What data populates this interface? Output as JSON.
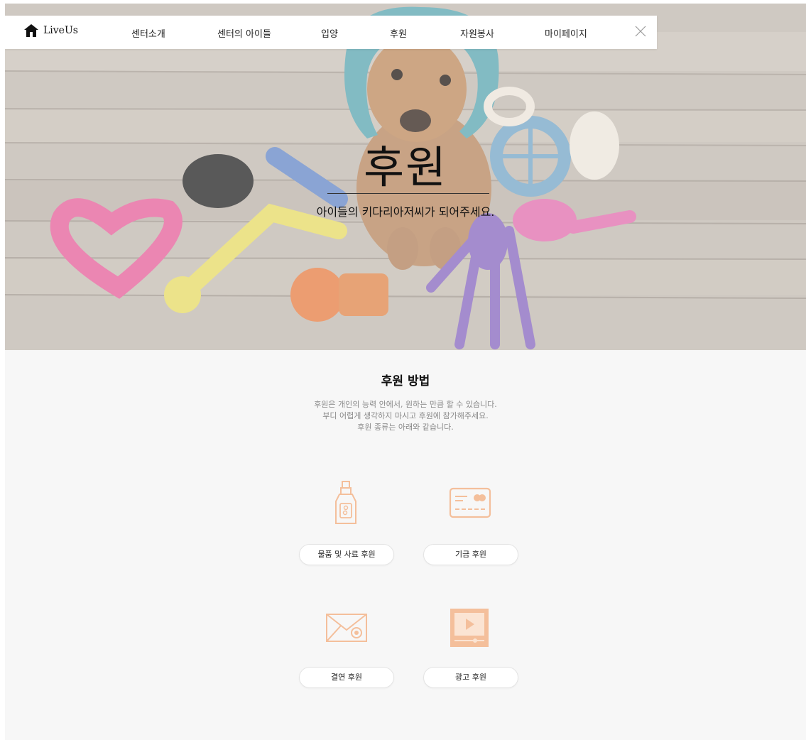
{
  "nav": {
    "logo_text": "LiveUs",
    "items": [
      {
        "label": "센터소개"
      },
      {
        "label": "센터의 아이들"
      },
      {
        "label": "입양"
      },
      {
        "label": "후원"
      },
      {
        "label": "자원봉사"
      },
      {
        "label": "마이페이지"
      }
    ]
  },
  "hero": {
    "title": "후원",
    "subtitle": "아이들의 키다리아저씨가 되어주세요."
  },
  "section": {
    "title": "후원 방법",
    "description": [
      "후원은 개인의 능력 안에서, 원하는 만큼 할 수 있습니다.",
      "부디 어렵게 생각하지 마시고 후원에 참가해주세요.",
      "후원 종류는 아래와 같습니다."
    ]
  },
  "options": [
    {
      "label": "물품 및 사료 후원",
      "icon": "supplies-bottle-icon"
    },
    {
      "label": "기금 후원",
      "icon": "credit-card-icon"
    },
    {
      "label": "결연 후원",
      "icon": "envelope-icon"
    },
    {
      "label": "광고 후원",
      "icon": "video-play-icon"
    }
  ],
  "colors": {
    "icon_accent": "#f4bf9b",
    "page_bg": "#f7f7f7"
  }
}
